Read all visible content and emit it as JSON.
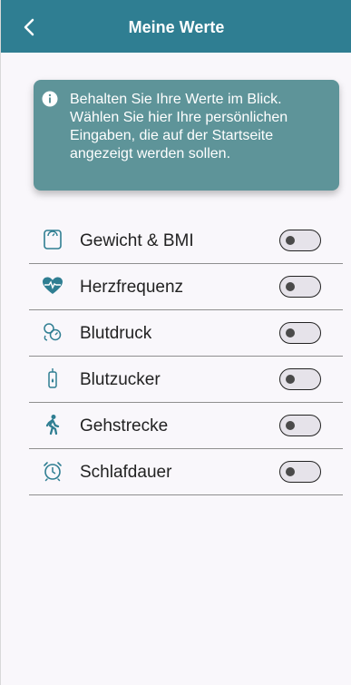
{
  "header": {
    "title": "Meine Werte"
  },
  "info": {
    "text": "Behalten Sie Ihre Werte im Blick. Wählen Sie hier Ihre persönlichen Eingaben, die auf der Startseite angezeigt werden sollen."
  },
  "items": [
    {
      "label": "Gewicht & BMI",
      "icon": "scale-icon",
      "enabled": false
    },
    {
      "label": "Herzfrequenz",
      "icon": "heart-rate-icon",
      "enabled": false
    },
    {
      "label": "Blutdruck",
      "icon": "blood-pressure-icon",
      "enabled": false
    },
    {
      "label": "Blutzucker",
      "icon": "blood-sugar-icon",
      "enabled": false
    },
    {
      "label": "Gehstrecke",
      "icon": "walking-icon",
      "enabled": false
    },
    {
      "label": "Schlafdauer",
      "icon": "alarm-clock-icon",
      "enabled": false
    }
  ],
  "colors": {
    "header": "#2f7e92",
    "info_box": "#5e9499",
    "icon_teal": "#2f7e92"
  }
}
